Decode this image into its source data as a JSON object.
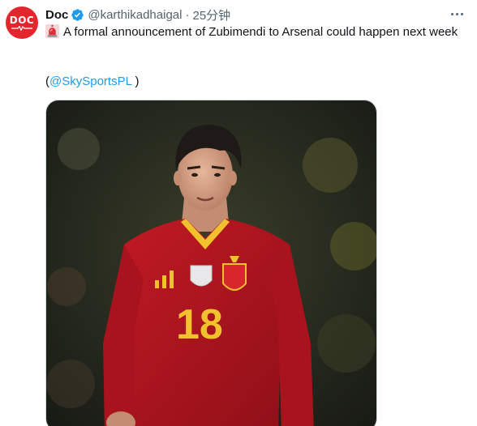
{
  "author": {
    "display_name": "Doc",
    "handle": "@karthikadhaigal",
    "separator": "·",
    "timestamp": "25分钟",
    "avatar_text": "DOC",
    "avatar_color": "#e3262d",
    "verified": true
  },
  "tweet": {
    "text": "A formal announcement of Zubimendi to Arsenal could happen next week",
    "emoji": "siren-icon",
    "credit_open": "(",
    "credit_mention": "@SkySportsPL",
    "credit_close": " )"
  },
  "media": {
    "jersey_number": "18",
    "description_icon": "player-photo"
  },
  "colors": {
    "link": "#1d9bf0",
    "secondary_text": "#536471",
    "verified": "#1d9bf0",
    "jersey_red": "#b3151f",
    "jersey_gold": "#f2c12e"
  }
}
